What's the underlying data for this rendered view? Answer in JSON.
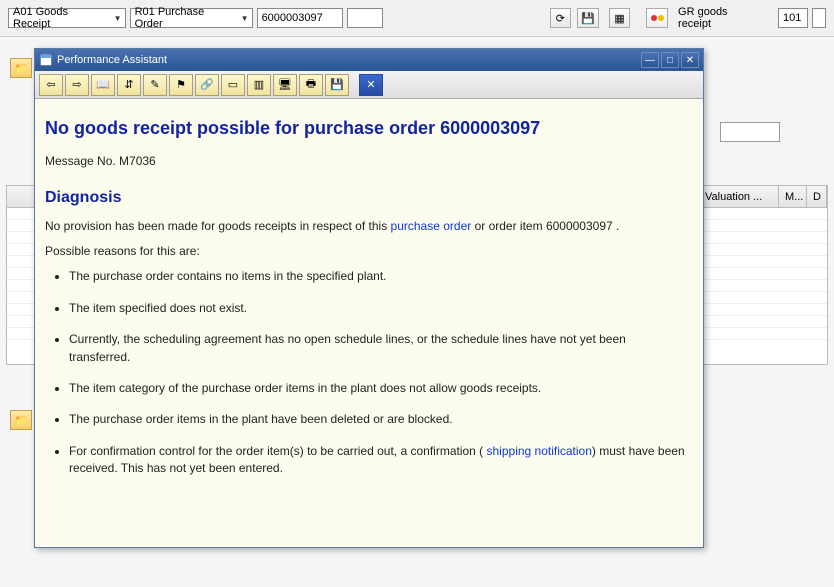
{
  "top": {
    "combo1": "A01 Goods Receipt",
    "combo2": "R01 Purchase Order",
    "po_number": "6000003097",
    "gr_label": "GR goods receipt",
    "code": "101"
  },
  "grid": {
    "cols": [
      "Valuation ...",
      "M...",
      "D"
    ]
  },
  "pa": {
    "title": "Performance Assistant",
    "heading": "No goods receipt possible for purchase order 6000003097",
    "msg_no": "Message No. M7036",
    "diag_h": "Diagnosis",
    "diag_p1_a": "No provision has been made for goods receipts in respect of this ",
    "diag_p1_link": "purchase order",
    "diag_p1_b": " or order item 6000003097 .",
    "reasons_intro": "Possible reasons for this are:",
    "reasons": [
      "The purchase order contains no items in the specified plant.",
      "The item specified does not exist.",
      "Currently, the scheduling agreement has no open schedule lines, or the schedule lines have not yet been transferred.",
      "The item category of the purchase order items in the plant does not allow goods receipts.",
      "The purchase order items in the plant have been deleted or are blocked."
    ],
    "reason6_a": "For confirmation control for the order item(s) to be carried out, a confirmation ( ",
    "reason6_link": "shipping notification",
    "reason6_b": ") must have been received. This has not yet been entered."
  }
}
